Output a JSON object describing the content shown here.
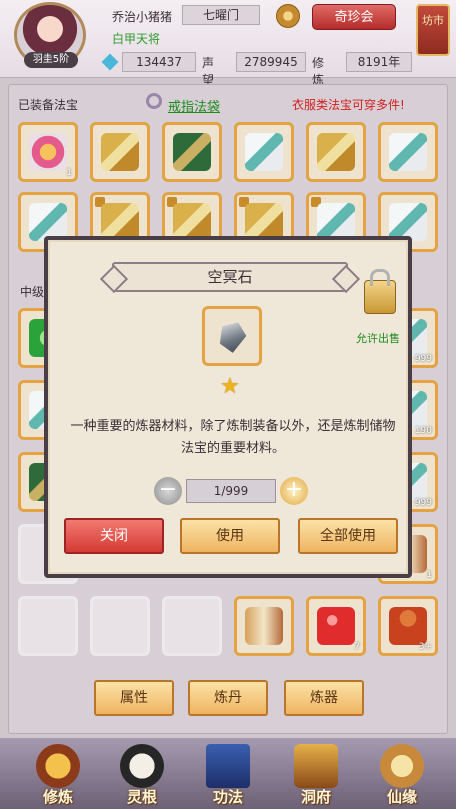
{
  "header": {
    "player_name": "乔治小猪猪",
    "sect": "七曜门",
    "avatar_rank": "羽圭5阶",
    "title": "白甲天将",
    "gems": "134437",
    "fame_label": "声望",
    "fame": "2789945",
    "cultivation_label": "修炼",
    "cultivation": "8191年",
    "treasure_button": "奇珍会",
    "market_button": "坊市"
  },
  "equipped": {
    "label": "已装备法宝",
    "ring_link": "戒指法袋",
    "notice": "衣服类法宝可穿多件!"
  },
  "middle": {
    "label": "中级"
  },
  "slots_counts": {
    "c1": "1",
    "c2": "999",
    "c3": "190",
    "c4": "999",
    "c5": "1",
    "c6": "7",
    "c7": "3+"
  },
  "dialog": {
    "title": "空冥石",
    "sell_label": "允许出售",
    "description": "一种重要的炼器材料，除了炼制装备以外，还是炼制储物法宝的重要材料。",
    "quantity": "1/999",
    "minus": "−",
    "plus": "+",
    "close_button": "关闭",
    "use_button": "使用",
    "use_all_button": "全部使用"
  },
  "bottom_buttons": {
    "attr": "属性",
    "alchemy": "炼丹",
    "forge": "炼器"
  },
  "nav": {
    "cultivate": "修炼",
    "spirit": "灵根",
    "skills": "功法",
    "cave": "洞府",
    "immortal": "仙缘"
  },
  "colors": {
    "accent": "#e3a342",
    "red": "#d33a33",
    "green": "#1c8c1c"
  }
}
